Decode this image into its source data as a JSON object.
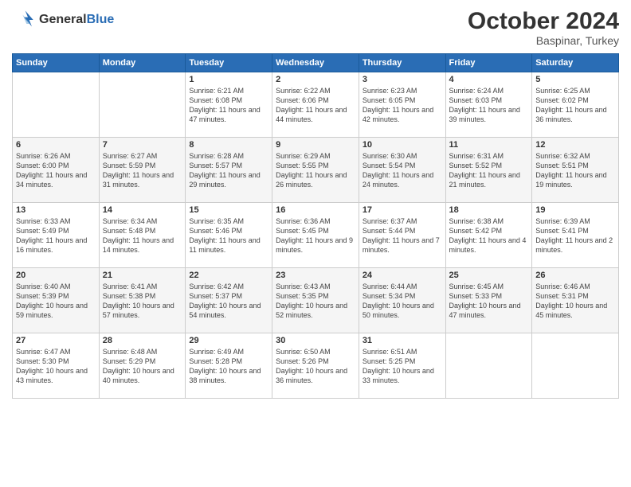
{
  "header": {
    "logo_line1": "General",
    "logo_line2": "Blue",
    "title": "October 2024",
    "subtitle": "Baspinar, Turkey"
  },
  "weekdays": [
    "Sunday",
    "Monday",
    "Tuesday",
    "Wednesday",
    "Thursday",
    "Friday",
    "Saturday"
  ],
  "weeks": [
    [
      {
        "day": "",
        "sunrise": "",
        "sunset": "",
        "daylight": ""
      },
      {
        "day": "",
        "sunrise": "",
        "sunset": "",
        "daylight": ""
      },
      {
        "day": "1",
        "sunrise": "Sunrise: 6:21 AM",
        "sunset": "Sunset: 6:08 PM",
        "daylight": "Daylight: 11 hours and 47 minutes."
      },
      {
        "day": "2",
        "sunrise": "Sunrise: 6:22 AM",
        "sunset": "Sunset: 6:06 PM",
        "daylight": "Daylight: 11 hours and 44 minutes."
      },
      {
        "day": "3",
        "sunrise": "Sunrise: 6:23 AM",
        "sunset": "Sunset: 6:05 PM",
        "daylight": "Daylight: 11 hours and 42 minutes."
      },
      {
        "day": "4",
        "sunrise": "Sunrise: 6:24 AM",
        "sunset": "Sunset: 6:03 PM",
        "daylight": "Daylight: 11 hours and 39 minutes."
      },
      {
        "day": "5",
        "sunrise": "Sunrise: 6:25 AM",
        "sunset": "Sunset: 6:02 PM",
        "daylight": "Daylight: 11 hours and 36 minutes."
      }
    ],
    [
      {
        "day": "6",
        "sunrise": "Sunrise: 6:26 AM",
        "sunset": "Sunset: 6:00 PM",
        "daylight": "Daylight: 11 hours and 34 minutes."
      },
      {
        "day": "7",
        "sunrise": "Sunrise: 6:27 AM",
        "sunset": "Sunset: 5:59 PM",
        "daylight": "Daylight: 11 hours and 31 minutes."
      },
      {
        "day": "8",
        "sunrise": "Sunrise: 6:28 AM",
        "sunset": "Sunset: 5:57 PM",
        "daylight": "Daylight: 11 hours and 29 minutes."
      },
      {
        "day": "9",
        "sunrise": "Sunrise: 6:29 AM",
        "sunset": "Sunset: 5:55 PM",
        "daylight": "Daylight: 11 hours and 26 minutes."
      },
      {
        "day": "10",
        "sunrise": "Sunrise: 6:30 AM",
        "sunset": "Sunset: 5:54 PM",
        "daylight": "Daylight: 11 hours and 24 minutes."
      },
      {
        "day": "11",
        "sunrise": "Sunrise: 6:31 AM",
        "sunset": "Sunset: 5:52 PM",
        "daylight": "Daylight: 11 hours and 21 minutes."
      },
      {
        "day": "12",
        "sunrise": "Sunrise: 6:32 AM",
        "sunset": "Sunset: 5:51 PM",
        "daylight": "Daylight: 11 hours and 19 minutes."
      }
    ],
    [
      {
        "day": "13",
        "sunrise": "Sunrise: 6:33 AM",
        "sunset": "Sunset: 5:49 PM",
        "daylight": "Daylight: 11 hours and 16 minutes."
      },
      {
        "day": "14",
        "sunrise": "Sunrise: 6:34 AM",
        "sunset": "Sunset: 5:48 PM",
        "daylight": "Daylight: 11 hours and 14 minutes."
      },
      {
        "day": "15",
        "sunrise": "Sunrise: 6:35 AM",
        "sunset": "Sunset: 5:46 PM",
        "daylight": "Daylight: 11 hours and 11 minutes."
      },
      {
        "day": "16",
        "sunrise": "Sunrise: 6:36 AM",
        "sunset": "Sunset: 5:45 PM",
        "daylight": "Daylight: 11 hours and 9 minutes."
      },
      {
        "day": "17",
        "sunrise": "Sunrise: 6:37 AM",
        "sunset": "Sunset: 5:44 PM",
        "daylight": "Daylight: 11 hours and 7 minutes."
      },
      {
        "day": "18",
        "sunrise": "Sunrise: 6:38 AM",
        "sunset": "Sunset: 5:42 PM",
        "daylight": "Daylight: 11 hours and 4 minutes."
      },
      {
        "day": "19",
        "sunrise": "Sunrise: 6:39 AM",
        "sunset": "Sunset: 5:41 PM",
        "daylight": "Daylight: 11 hours and 2 minutes."
      }
    ],
    [
      {
        "day": "20",
        "sunrise": "Sunrise: 6:40 AM",
        "sunset": "Sunset: 5:39 PM",
        "daylight": "Daylight: 10 hours and 59 minutes."
      },
      {
        "day": "21",
        "sunrise": "Sunrise: 6:41 AM",
        "sunset": "Sunset: 5:38 PM",
        "daylight": "Daylight: 10 hours and 57 minutes."
      },
      {
        "day": "22",
        "sunrise": "Sunrise: 6:42 AM",
        "sunset": "Sunset: 5:37 PM",
        "daylight": "Daylight: 10 hours and 54 minutes."
      },
      {
        "day": "23",
        "sunrise": "Sunrise: 6:43 AM",
        "sunset": "Sunset: 5:35 PM",
        "daylight": "Daylight: 10 hours and 52 minutes."
      },
      {
        "day": "24",
        "sunrise": "Sunrise: 6:44 AM",
        "sunset": "Sunset: 5:34 PM",
        "daylight": "Daylight: 10 hours and 50 minutes."
      },
      {
        "day": "25",
        "sunrise": "Sunrise: 6:45 AM",
        "sunset": "Sunset: 5:33 PM",
        "daylight": "Daylight: 10 hours and 47 minutes."
      },
      {
        "day": "26",
        "sunrise": "Sunrise: 6:46 AM",
        "sunset": "Sunset: 5:31 PM",
        "daylight": "Daylight: 10 hours and 45 minutes."
      }
    ],
    [
      {
        "day": "27",
        "sunrise": "Sunrise: 6:47 AM",
        "sunset": "Sunset: 5:30 PM",
        "daylight": "Daylight: 10 hours and 43 minutes."
      },
      {
        "day": "28",
        "sunrise": "Sunrise: 6:48 AM",
        "sunset": "Sunset: 5:29 PM",
        "daylight": "Daylight: 10 hours and 40 minutes."
      },
      {
        "day": "29",
        "sunrise": "Sunrise: 6:49 AM",
        "sunset": "Sunset: 5:28 PM",
        "daylight": "Daylight: 10 hours and 38 minutes."
      },
      {
        "day": "30",
        "sunrise": "Sunrise: 6:50 AM",
        "sunset": "Sunset: 5:26 PM",
        "daylight": "Daylight: 10 hours and 36 minutes."
      },
      {
        "day": "31",
        "sunrise": "Sunrise: 6:51 AM",
        "sunset": "Sunset: 5:25 PM",
        "daylight": "Daylight: 10 hours and 33 minutes."
      },
      {
        "day": "",
        "sunrise": "",
        "sunset": "",
        "daylight": ""
      },
      {
        "day": "",
        "sunrise": "",
        "sunset": "",
        "daylight": ""
      }
    ]
  ]
}
